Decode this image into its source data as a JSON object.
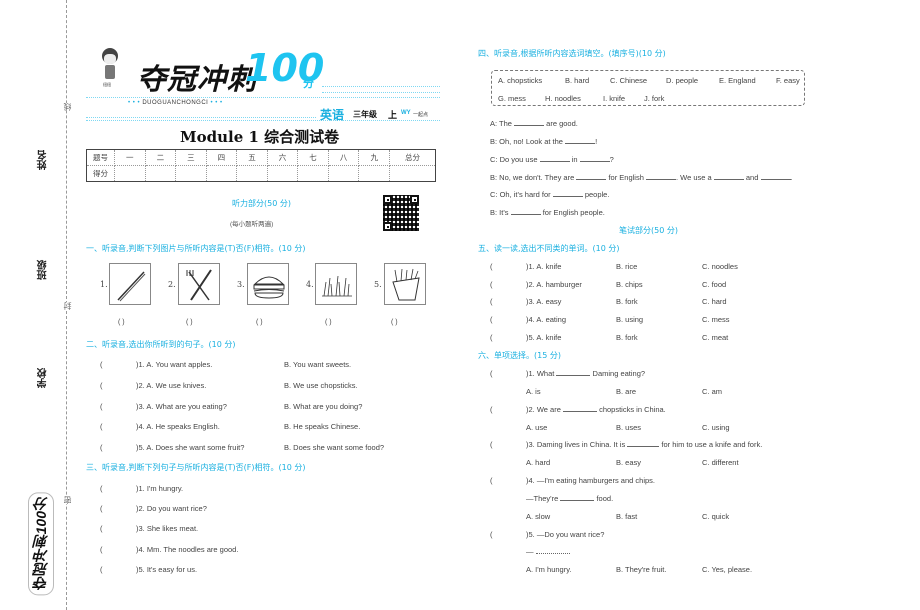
{
  "margin": {
    "name_label": "姓名",
    "class_label": "班级",
    "school_label": "学校",
    "cut_marks": [
      "线",
      "封",
      "密"
    ],
    "side_brand": "夺冠冲刺100分"
  },
  "header": {
    "brand": "夺冠冲刺",
    "brand_score": "100",
    "brand_unit": "分",
    "pinyin": "DUOGUANCHONGCI",
    "mascot_tag": "纽纽",
    "subject": "英语",
    "grade": "三年级",
    "volume": "上",
    "edition": "WY",
    "edition_note": "一起点",
    "title": "Module 1 综合测试卷"
  },
  "score_table": {
    "row1": [
      "题号",
      "一",
      "二",
      "三",
      "四",
      "五",
      "六",
      "七",
      "八",
      "九",
      "总分"
    ],
    "row2_label": "得分"
  },
  "listening": {
    "heading": "听力部分(50 分)",
    "note": "(每小题听两遍)",
    "qr_icon": "qr-code"
  },
  "section1": {
    "title": "一、听录音,判断下列图片与所听内容是(T)否(F)相符。(10 分)",
    "items": [
      {
        "num": "1.",
        "image": "chopsticks"
      },
      {
        "num": "2.",
        "image": "knife-and-fork"
      },
      {
        "num": "3.",
        "image": "hamburger"
      },
      {
        "num": "4.",
        "image": "grass"
      },
      {
        "num": "5.",
        "image": "chips"
      }
    ],
    "answer_paren": "(      )"
  },
  "section2": {
    "title": "二、听录音,选出你所听到的句子。(10 分)",
    "items": [
      {
        "num": ")1. A. You want apples.",
        "b": "B. You want sweets."
      },
      {
        "num": ")2. A. We use knives.",
        "b": "B. We use chopsticks."
      },
      {
        "num": ")3. A. What are you eating?",
        "b": "B. What are you doing?"
      },
      {
        "num": ")4. A. He speaks English.",
        "b": "B. He speaks Chinese."
      },
      {
        "num": ")5. A. Does she want some fruit?",
        "b": "B. Does she want some food?"
      }
    ]
  },
  "section3": {
    "title": "三、听录音,判断下列句子与所听内容是(T)否(F)相符。(10 分)",
    "items": [
      ")1. I'm hungry.",
      ")2. Do you want rice?",
      ")3. She likes meat.",
      ")4. Mm. The noodles are good.",
      ")5. It's easy for us."
    ]
  },
  "section4": {
    "title": "四、听录音,根据所听内容选词填空。(填序号)(10 分)",
    "words_row1": [
      "A. chopsticks",
      "B. hard",
      "C. Chinese",
      "D. people",
      "E. England",
      "F. easy"
    ],
    "words_row2": [
      "G. mess",
      "H. noodles",
      "I. knife",
      "J. fork"
    ],
    "dialogue": [
      {
        "a": "A: The",
        "b": "are good."
      },
      {
        "a": "B: Oh, no! Look at the",
        "b": "!"
      },
      {
        "a": "C: Do you use",
        "b": "in",
        "c": "?"
      },
      {
        "a": "B: No, we don't. They are",
        "b": "for English",
        "c": ". We use a",
        "d": "and",
        "e": "."
      },
      {
        "a": "C: Oh, it's hard for",
        "b": "people."
      },
      {
        "a": "B: It's",
        "b": "for English people."
      }
    ]
  },
  "written": {
    "heading": "笔试部分(50 分)"
  },
  "section5": {
    "title": "五、读一读,选出不同类的单词。(10 分)",
    "items": [
      {
        "a": ")1. A. knife",
        "b": "B. rice",
        "c": "C. noodles"
      },
      {
        "a": ")2. A. hamburger",
        "b": "B. chips",
        "c": "C. food"
      },
      {
        "a": ")3. A. easy",
        "b": "B. fork",
        "c": "C. hard"
      },
      {
        "a": ")4. A. eating",
        "b": "B. using",
        "c": "C. mess"
      },
      {
        "a": ")5. A. knife",
        "b": "B. fork",
        "c": "C. meat"
      }
    ]
  },
  "section6": {
    "title": "六、单项选择。(15 分)",
    "q1": {
      "stem_a": ")1. What",
      "stem_b": "Daming eating?",
      "opts": [
        "A. is",
        "B. are",
        "C. am"
      ]
    },
    "q2": {
      "stem_a": ")2. We are",
      "stem_b": "chopsticks in China.",
      "opts": [
        "A. use",
        "B. uses",
        "C. using"
      ]
    },
    "q3": {
      "stem_a": ")3. Daming lives in China. It is",
      "stem_b": "for him to use a knife and fork.",
      "opts": [
        "A. hard",
        "B. easy",
        "C. different"
      ]
    },
    "q4": {
      "stem": ")4. —I'm eating hamburgers and chips.",
      "reply_a": "—They're",
      "reply_b": "food.",
      "opts": [
        "A. slow",
        "B. fast",
        "C. quick"
      ]
    },
    "q5": {
      "stem": ")5. —Do you want rice?",
      "reply": "—",
      "opts": [
        "A. I'm hungry.",
        "B. They're fruit.",
        "C. Yes, please."
      ]
    }
  },
  "paren_open": "("
}
